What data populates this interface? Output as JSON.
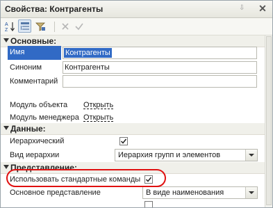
{
  "window": {
    "title": "Свойства: Контрагенты",
    "pin_glyph": "⇩",
    "close_glyph": "✕"
  },
  "toolbar": {
    "icons": [
      "sort-alphabet-icon",
      "categorized-view-icon",
      "filter-icon",
      "delete-icon",
      "checkmark-icon"
    ]
  },
  "sections": {
    "basic": "Основные:",
    "data": "Данные:",
    "presentation": "Представление:"
  },
  "properties": {
    "name_label": "Имя",
    "name_value": "Контрагенты",
    "synonym_label": "Синоним",
    "synonym_value": "Контрагенты",
    "comment_label": "Комментарий",
    "comment_value": "",
    "object_module_label": "Модуль объекта",
    "object_module_link": "Открыть",
    "manager_module_label": "Модуль менеджера",
    "manager_module_link": "Открыть",
    "hierarchical_label": "Иерархический",
    "hierarchical_checked": true,
    "hierarchy_type_label": "Вид иерархии",
    "hierarchy_type_value": "Иерархия групп и элементов",
    "use_std_commands_label": "Использовать стандартные команды",
    "use_std_commands_checked": true,
    "main_presentation_label": "Основное представление",
    "main_presentation_value": "В виде наименования"
  },
  "colors": {
    "selection": "#316ac5",
    "highlight_oval": "#e01010"
  }
}
